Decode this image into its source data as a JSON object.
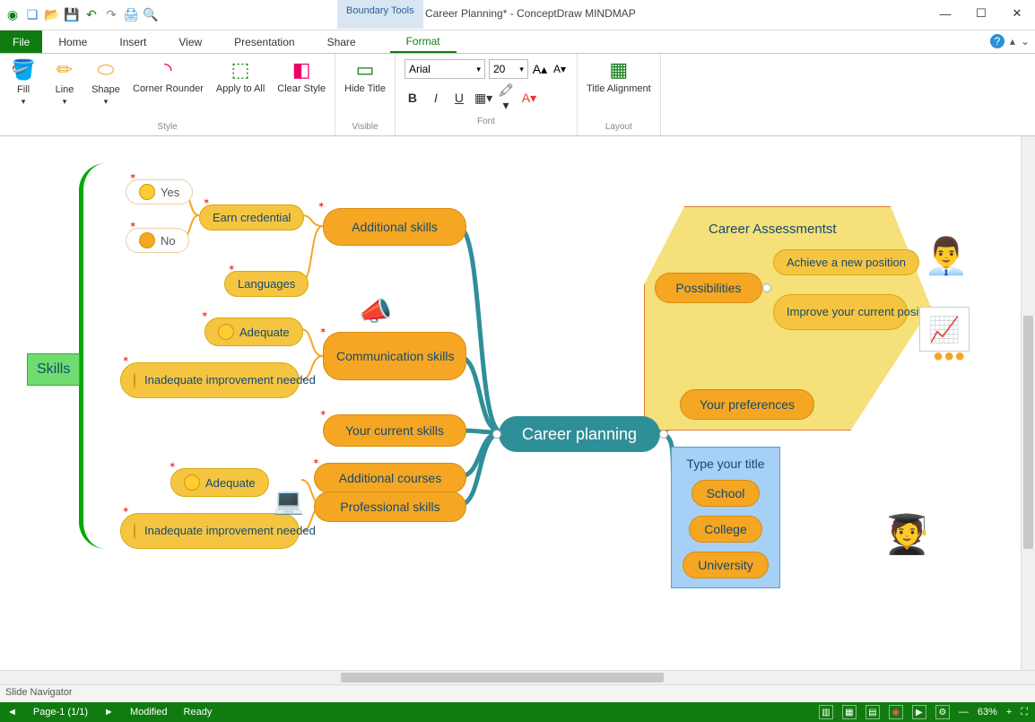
{
  "title": "Career Planning* - ConceptDraw MINDMAP",
  "context_tab": "Boundary Tools",
  "tabs": {
    "file": "File",
    "home": "Home",
    "insert": "Insert",
    "view": "View",
    "presentation": "Presentation",
    "share": "Share",
    "format": "Format"
  },
  "ribbon": {
    "fill": "Fill",
    "line": "Line",
    "shape": "Shape",
    "corner": "Corner Rounder",
    "apply": "Apply to All",
    "clear": "Clear Style",
    "hide": "Hide Title",
    "visible_label": "Visible",
    "style_label": "Style",
    "font_label": "Font",
    "layout_label": "Layout",
    "font_name": "Arial",
    "font_size": "20",
    "title_align": "Title Alignment"
  },
  "map": {
    "root": "Career planning",
    "left": {
      "skills_group": "Skills",
      "additional_skills": "Additional skills",
      "earn_credential": "Earn credential",
      "languages": "Languages",
      "yes": "Yes",
      "no": "No",
      "communication": "Communication skills",
      "adequate": "Adequate",
      "inadequate": "Inadequate improvement needed",
      "your_current": "Your current skills",
      "additional_courses": "Additional courses",
      "professional": "Professional skills"
    },
    "right": {
      "assess_title": "Career Assessmentst",
      "possibilities": "Possibilities",
      "achieve": "Achieve a new position",
      "improve": "Improve your current position",
      "preferences": "Your preferences",
      "type_title": "Type your title",
      "school": "School",
      "college": "College",
      "university": "University"
    }
  },
  "slidenav": "Slide Navigator",
  "status": {
    "page": "Page-1 (1/1)",
    "modified": "Modified",
    "ready": "Ready",
    "zoom": "63%"
  }
}
